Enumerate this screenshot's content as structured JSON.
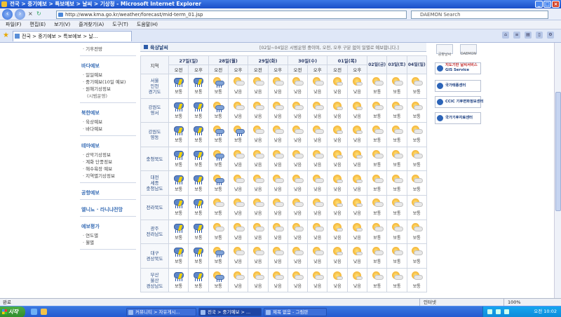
{
  "window": {
    "title": "전국 > 중기예보 > 특보예보 > 날씨 > 기상청 - Microsoft Internet Explorer",
    "url": "http://www.kma.go.kr/weather/forecast/mid-term_01.jsp",
    "search_placeholder": "DAEMON Search",
    "tab_title": "전국 > 중기예보 > 특보예보 > 날..."
  },
  "menu": [
    "파일(F)",
    "편집(E)",
    "보기(V)",
    "즐겨찾기(A)",
    "도구(T)",
    "도움말(H)"
  ],
  "sidebar": {
    "sections": [
      {
        "heading": "",
        "items": [
          "기후전망"
        ]
      },
      {
        "heading": "바다예보",
        "items": [
          "일일예보",
          "중기예보(10일 예보)",
          "원해기상정보",
          "(시범운영)"
        ]
      },
      {
        "heading": "북한예보",
        "items": [
          "육상예보",
          "바다예보"
        ]
      },
      {
        "heading": "테마예보",
        "items": [
          "산악기상정보",
          "계화 단풍정보",
          "해수욕장 예보",
          "지역별기상정보"
        ]
      },
      {
        "heading": "공항예보",
        "items": []
      },
      {
        "heading": "엘니뇨 · 라니냐전망",
        "items": []
      },
      {
        "heading": "예보평가",
        "items": [
          "연도별",
          "월별"
        ]
      }
    ]
  },
  "forecast": {
    "section_title": "육상날씨",
    "notice": "[02일~04일은 시범운영 중이며, 오전, 오후 구분 없이 일별로 예보합니다.]",
    "region_header": "지역",
    "dates": [
      {
        "label": "27일(일)",
        "span": 2
      },
      {
        "label": "28일(월)",
        "span": 2
      },
      {
        "label": "29일(화)",
        "span": 2
      },
      {
        "label": "30일(수)",
        "span": 2
      },
      {
        "label": "01일(목)",
        "span": 2
      },
      {
        "label": "02일(금)",
        "span": 1
      },
      {
        "label": "03일(토)",
        "span": 1
      },
      {
        "label": "04일(일)",
        "span": 1
      }
    ],
    "periods": [
      "오전",
      "오후",
      "오전",
      "오후",
      "오전",
      "오후",
      "오전",
      "오후",
      "오전",
      "오후"
    ],
    "rows": [
      {
        "region": [
          "서울",
          "인천",
          "경기도"
        ],
        "cells": [
          [
            "rain",
            "보통"
          ],
          [
            "rain",
            "보통"
          ],
          [
            "partly",
            "보통"
          ],
          [
            "cloudy",
            "낮음"
          ],
          [
            "cloudy",
            "낮음"
          ],
          [
            "cloudy",
            "낮음"
          ],
          [
            "cloudy",
            "낮음"
          ],
          [
            "cloudy",
            "낮음"
          ],
          [
            "sun",
            "낮음"
          ],
          [
            "sun",
            "낮음"
          ],
          [
            "cloudy",
            "보통"
          ],
          [
            "cloudy",
            "보통"
          ],
          [
            "cloudy",
            "보통"
          ]
        ]
      },
      {
        "region": [
          "강원도",
          "영서"
        ],
        "cells": [
          [
            "rain",
            "보통"
          ],
          [
            "rain",
            "보통"
          ],
          [
            "partly",
            "보통"
          ],
          [
            "cloudy",
            "낮음"
          ],
          [
            "cloudy",
            "낮음"
          ],
          [
            "cloudy",
            "낮음"
          ],
          [
            "cloudy",
            "낮음"
          ],
          [
            "cloudy",
            "낮음"
          ],
          [
            "sun",
            "낮음"
          ],
          [
            "sun",
            "낮음"
          ],
          [
            "cloudy",
            "보통"
          ],
          [
            "cloudy",
            "보통"
          ],
          [
            "cloudy",
            "보통"
          ]
        ]
      },
      {
        "region": [
          "강원도",
          "영동"
        ],
        "cells": [
          [
            "rain",
            "보통"
          ],
          [
            "rain",
            "보통"
          ],
          [
            "partly",
            "보통"
          ],
          [
            "partly",
            "보통"
          ],
          [
            "cloudy",
            "낮음"
          ],
          [
            "cloudy",
            "낮음"
          ],
          [
            "cloudy",
            "낮음"
          ],
          [
            "cloudy",
            "낮음"
          ],
          [
            "sun",
            "낮음"
          ],
          [
            "sun",
            "낮음"
          ],
          [
            "cloudy",
            "보통"
          ],
          [
            "cloudy",
            "보통"
          ],
          [
            "cloudy",
            "보통"
          ]
        ]
      },
      {
        "region": [
          "충청북도"
        ],
        "cells": [
          [
            "rain",
            "보통"
          ],
          [
            "rain",
            "보통"
          ],
          [
            "partly",
            "보통"
          ],
          [
            "cloudy",
            "낮음"
          ],
          [
            "cloudy",
            "낮음"
          ],
          [
            "cloudy",
            "낮음"
          ],
          [
            "cloudy",
            "낮음"
          ],
          [
            "cloudy",
            "낮음"
          ],
          [
            "sun",
            "낮음"
          ],
          [
            "sun",
            "낮음"
          ],
          [
            "cloudy",
            "보통"
          ],
          [
            "cloudy",
            "보통"
          ],
          [
            "cloudy",
            "보통"
          ]
        ]
      },
      {
        "region": [
          "대전",
          "세종",
          "충청남도"
        ],
        "cells": [
          [
            "rain",
            "보통"
          ],
          [
            "rain",
            "보통"
          ],
          [
            "partly",
            "보통"
          ],
          [
            "cloudy",
            "낮음"
          ],
          [
            "cloudy",
            "낮음"
          ],
          [
            "cloudy",
            "낮음"
          ],
          [
            "cloudy",
            "낮음"
          ],
          [
            "cloudy",
            "낮음"
          ],
          [
            "sun",
            "낮음"
          ],
          [
            "sun",
            "낮음"
          ],
          [
            "cloudy",
            "보통"
          ],
          [
            "cloudy",
            "보통"
          ],
          [
            "cloudy",
            "보통"
          ]
        ]
      },
      {
        "region": [
          "전라북도"
        ],
        "cells": [
          [
            "rain",
            "보통"
          ],
          [
            "rain",
            "보통"
          ],
          [
            "cloudy",
            "보통"
          ],
          [
            "cloudy",
            "낮음"
          ],
          [
            "cloudy",
            "낮음"
          ],
          [
            "cloudy",
            "낮음"
          ],
          [
            "cloudy",
            "낮음"
          ],
          [
            "cloudy",
            "낮음"
          ],
          [
            "sun",
            "낮음"
          ],
          [
            "sun",
            "낮음"
          ],
          [
            "cloudy",
            "보통"
          ],
          [
            "cloudy",
            "보통"
          ],
          [
            "cloudy",
            "보통"
          ]
        ]
      },
      {
        "region": [
          "광주",
          "전라남도"
        ],
        "cells": [
          [
            "rain",
            "보통"
          ],
          [
            "rain",
            "보통"
          ],
          [
            "cloudy",
            "보통"
          ],
          [
            "cloudy",
            "낮음"
          ],
          [
            "cloudy",
            "낮음"
          ],
          [
            "cloudy",
            "낮음"
          ],
          [
            "cloudy",
            "낮음"
          ],
          [
            "cloudy",
            "낮음"
          ],
          [
            "sun",
            "낮음"
          ],
          [
            "sun",
            "낮음"
          ],
          [
            "cloudy",
            "보통"
          ],
          [
            "cloudy",
            "보통"
          ],
          [
            "cloudy",
            "보통"
          ]
        ]
      },
      {
        "region": [
          "대구",
          "경상북도"
        ],
        "cells": [
          [
            "rain",
            "보통"
          ],
          [
            "rain",
            "보통"
          ],
          [
            "partly",
            "보통"
          ],
          [
            "cloudy",
            "낮음"
          ],
          [
            "cloudy",
            "낮음"
          ],
          [
            "cloudy",
            "낮음"
          ],
          [
            "cloudy",
            "낮음"
          ],
          [
            "cloudy",
            "낮음"
          ],
          [
            "sun",
            "낮음"
          ],
          [
            "sun",
            "낮음"
          ],
          [
            "cloudy",
            "보통"
          ],
          [
            "cloudy",
            "보통"
          ],
          [
            "cloudy",
            "보통"
          ]
        ]
      },
      {
        "region": [
          "부산",
          "울산",
          "경상남도"
        ],
        "cells": [
          [
            "rain",
            "보통"
          ],
          [
            "rain",
            "보통"
          ],
          [
            "partly",
            "보통"
          ],
          [
            "cloudy",
            "낮음"
          ],
          [
            "cloudy",
            "낮음"
          ],
          [
            "cloudy",
            "낮음"
          ],
          [
            "cloudy",
            "낮음"
          ],
          [
            "cloudy",
            "낮음"
          ],
          [
            "sun",
            "낮음"
          ],
          [
            "sun",
            "낮음"
          ],
          [
            "cloudy",
            "보통"
          ],
          [
            "cloudy",
            "보통"
          ],
          [
            "cloudy",
            "보통"
          ]
        ]
      }
    ]
  },
  "right_panel": {
    "top_icons": [
      "공항날씨",
      "DAEMON"
    ],
    "banners": [
      {
        "line1": "지도기반 날씨서비스",
        "line2": "GIS Service"
      },
      {
        "line1": "",
        "line2": "국가태풍센터"
      },
      {
        "line1": "CCIC 기후변화정보센터",
        "line2": ""
      },
      {
        "line1": "",
        "line2": "국가기후자료센터"
      }
    ]
  },
  "status": {
    "left": "완료",
    "zone": "인터넷",
    "zoom": "100%"
  },
  "taskbar": {
    "start": "시작",
    "buttons": [
      "커뮤니티 > 자유게시...",
      "전국 > 중기예보 > ...",
      "제목 없음 - 그림판"
    ],
    "clock": "오전 10:02"
  }
}
